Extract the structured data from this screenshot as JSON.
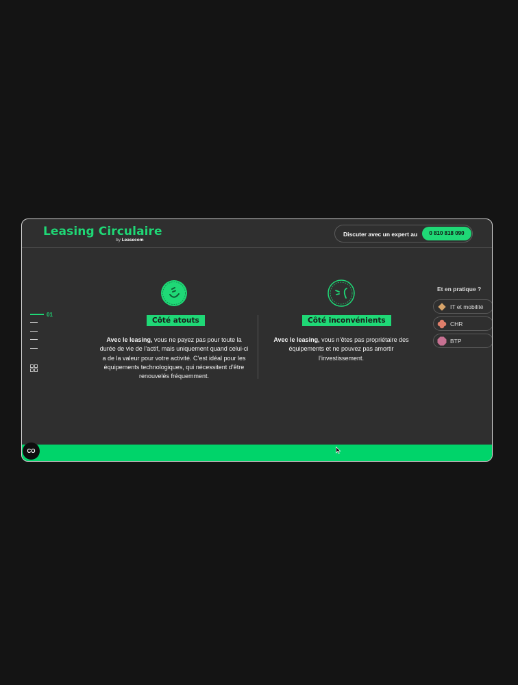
{
  "header": {
    "brand_title": "Leasing Circulaire",
    "brand_by": "by",
    "brand_company": "Leasecom",
    "cta_label": "Discuter avec un expert au",
    "cta_phone": "0 810 818 090"
  },
  "pager": {
    "current": "01"
  },
  "columns": [
    {
      "tag": "Côté atouts",
      "lead": "Avec le leasing,",
      "text": " vous ne payez pas pour toute la durée de vie de l’actif, mais uniquement quand celui-ci a de la valeur pour votre activité. C’est idéal pour les équipements technologiques, qui nécessitent d’être renouvelés fréquemment.",
      "icon": "happy-face-icon"
    },
    {
      "tag": "Côté inconvénients",
      "lead": "Avec le leasing,",
      "text": " vous n’êtes pas propriétaire des équipements et ne pouvez pas amortir l’investissement.",
      "icon": "sad-face-icon"
    }
  ],
  "practice": {
    "title": "Et en pratique ?",
    "items": [
      {
        "label": "IT et mobilité",
        "icon": "diamond-icon",
        "color": "#d8a46a"
      },
      {
        "label": "CHR",
        "icon": "flower-icon",
        "color": "#e07f6b"
      },
      {
        "label": "BTP",
        "icon": "octagon-icon",
        "color": "#c77192"
      }
    ]
  },
  "badge": {
    "label": "CO"
  },
  "colors": {
    "accent": "#1fd876",
    "band": "#00d46a",
    "background": "#141414",
    "panel": "#2f2f2f"
  }
}
